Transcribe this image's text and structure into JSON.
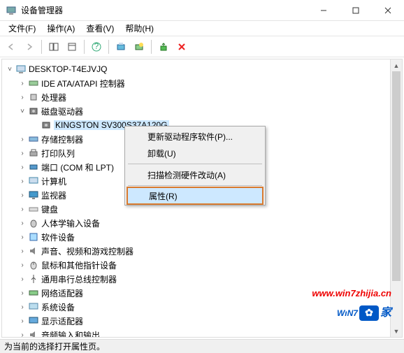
{
  "window": {
    "title": "设备管理器"
  },
  "menu": {
    "file": "文件(F)",
    "action": "操作(A)",
    "view": "查看(V)",
    "help": "帮助(H)"
  },
  "tree": {
    "root": "DESKTOP-T4EJVJQ",
    "ide": "IDE ATA/ATAPI 控制器",
    "cpu": "处理器",
    "disk": "磁盘驱动器",
    "disk_child": "KINGSTON SV300S37A120G",
    "storage": "存储控制器",
    "printq": "打印队列",
    "ports": "端口 (COM 和 LPT)",
    "computer": "计算机",
    "monitor": "监视器",
    "keyboard": "键盘",
    "hid": "人体学输入设备",
    "software": "软件设备",
    "sound": "声音、视频和游戏控制器",
    "mouse": "鼠标和其他指针设备",
    "usb": "通用串行总线控制器",
    "net": "网络适配器",
    "system": "系统设备",
    "display": "显示适配器",
    "audio": "音频输入和输出"
  },
  "context": {
    "update": "更新驱动程序软件(P)...",
    "uninstall": "卸载(U)",
    "scan": "扫描检测硬件改动(A)",
    "properties": "属性(R)"
  },
  "status": "为当前的选择打开属性页。",
  "watermark": {
    "url": "www.win7zhijia.cn",
    "brand_win": "WıN",
    "brand_7": "7",
    "brand_badge": "✿",
    "brand_han": "家"
  }
}
